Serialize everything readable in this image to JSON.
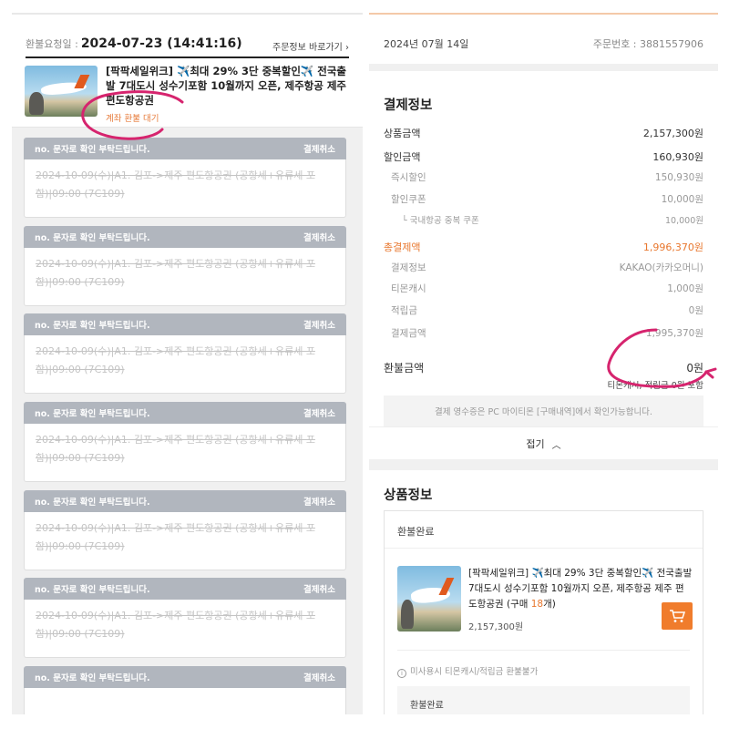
{
  "left": {
    "request_label": "환불요청일 :",
    "request_date": "2024-07-23 (14:41:16)",
    "shortcut": "주문정보 바로가기",
    "product_title": "[팍팍세일위크] ✈️최대 29% 3단 중복할인✈️ 전국출발 7대도시 성수기포함 10월까지 오픈, 제주항공 제주 편도항공권",
    "status": "계좌 환불 대기",
    "cards": [
      {
        "header": "no. 문자로 확인 부탁드립니다.",
        "action": "결제취소",
        "line1": "2024-10-09(수)|A1. 김포->제주 편도항공권 (공항세+유류세 포",
        "line2": "함)|09:00 (7C109)"
      },
      {
        "header": "no. 문자로 확인 부탁드립니다.",
        "action": "결제취소",
        "line1": "2024-10-09(수)|A1. 김포->제주 편도항공권 (공항세+유류세 포",
        "line2": "함)|09:00 (7C109)"
      },
      {
        "header": "no. 문자로 확인 부탁드립니다.",
        "action": "결제취소",
        "line1": "2024-10-09(수)|A1. 김포->제주 편도항공권 (공항세+유류세 포",
        "line2": "함)|09:00 (7C109)"
      },
      {
        "header": "no. 문자로 확인 부탁드립니다.",
        "action": "결제취소",
        "line1": "2024-10-09(수)|A1. 김포->제주 편도항공권 (공항세+유류세 포",
        "line2": "함)|09:00 (7C109)"
      },
      {
        "header": "no. 문자로 확인 부탁드립니다.",
        "action": "결제취소",
        "line1": "2024-10-09(수)|A1. 김포->제주 편도항공권 (공항세+유류세 포",
        "line2": "함)|09:00 (7C109)"
      },
      {
        "header": "no. 문자로 확인 부탁드립니다.",
        "action": "결제취소",
        "line1": "2024-10-09(수)|A1. 김포->제주 편도항공권 (공항세+유류세 포",
        "line2": "함)|09:00 (7C109)"
      },
      {
        "header": "no. 문자로 확인 부탁드립니다.",
        "action": "결제취소",
        "line1": "",
        "line2": ""
      }
    ]
  },
  "right": {
    "order_date": "2024년 07월 14일",
    "order_number": "주문번호 : 3881557906",
    "payment_title": "결제정보",
    "rows": [
      {
        "label": "상품금액",
        "value": "2,157,300원"
      },
      {
        "label": "할인금액",
        "value": "160,930원"
      },
      {
        "label": "즉시할인",
        "value": "150,930원"
      },
      {
        "label": "할인쿠폰",
        "value": "10,000원"
      },
      {
        "label": "└ 국내항공 중복 쿠폰",
        "value": "10,000원"
      },
      {
        "label": "총결제액",
        "value": "1,996,370원"
      },
      {
        "label": "결제정보",
        "value": "KAKAO(카카오머니)"
      },
      {
        "label": "티몬캐시",
        "value": "1,000원"
      },
      {
        "label": "적립금",
        "value": "0원"
      },
      {
        "label": "결제금액",
        "value": "1,995,370원"
      },
      {
        "label": "환불금액",
        "value": "0원"
      }
    ],
    "refund_note": "티몬캐시, 적립금 0원 포함",
    "receipt_note": "결제 영수증은 PC 마이티몬 [구매내역]에서 확인가능합니다.",
    "fold_label": "접기",
    "product_section_title": "상품정보",
    "refund_status": "환불완료",
    "product_title_a": "[팍팍세일위크] ✈️최대 29% 3단 중복할인✈️ 전국출발 7대도시 성수기포함 10월까지 오픈, 제주항공 제주 편도항공권 (구매 ",
    "purchase_count": "18",
    "product_title_b": "개)",
    "product_price": "2,157,300원",
    "warning": "미사용시 티몬캐시/적립금 환불불가",
    "refund_status_2": "환불완료"
  },
  "colors": {
    "accent": "#e8772e",
    "annotation": "#d6246e"
  }
}
